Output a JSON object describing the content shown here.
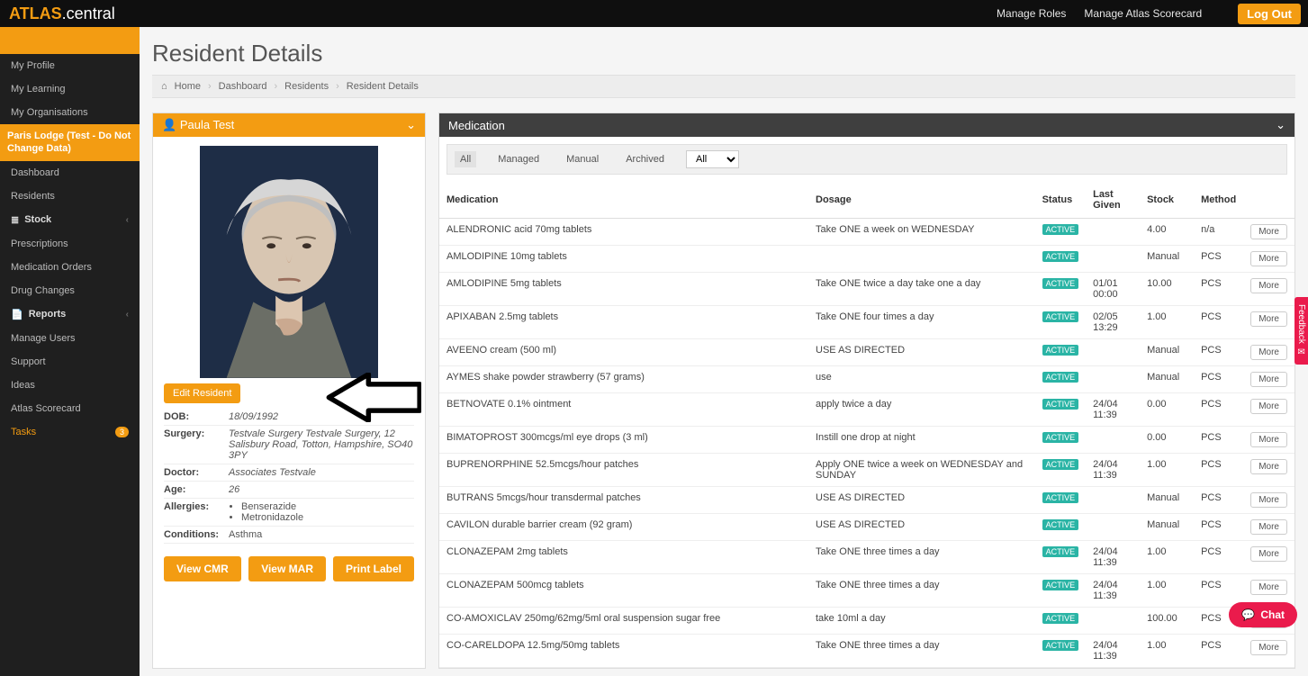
{
  "brand": {
    "part1": "ATLAS",
    "part2": ".central"
  },
  "top_nav": {
    "roles": "Manage Roles",
    "scorecard": "Manage Atlas Scorecard",
    "logout": "Log Out"
  },
  "sidebar": {
    "profile": "My Profile",
    "learning": "My Learning",
    "orgs": "My Organisations",
    "site": "Paris Lodge (Test - Do Not Change Data)",
    "dashboard": "Dashboard",
    "residents": "Residents",
    "stock": "Stock",
    "prescriptions": "Prescriptions",
    "med_orders": "Medication Orders",
    "drug_changes": "Drug Changes",
    "reports": "Reports",
    "manage_users": "Manage Users",
    "support": "Support",
    "ideas": "Ideas",
    "scorecard": "Atlas Scorecard",
    "tasks": "Tasks",
    "tasks_count": "3"
  },
  "page_title": "Resident Details",
  "breadcrumbs": [
    "Home",
    "Dashboard",
    "Residents",
    "Resident Details"
  ],
  "resident": {
    "name": "Paula Test",
    "edit_btn": "Edit Resident",
    "labels": {
      "dob": "DOB:",
      "surgery": "Surgery:",
      "doctor": "Doctor:",
      "age": "Age:",
      "allergies": "Allergies:",
      "conditions": "Conditions:"
    },
    "dob": "18/09/1992",
    "surgery": "Testvale Surgery Testvale Surgery, 12 Salisbury Road, Totton, Hampshire, SO40 3PY",
    "doctor": "Associates Testvale",
    "age": "26",
    "allergies": [
      "Benserazide",
      "Metronidazole"
    ],
    "conditions": "Asthma",
    "view_cmr": "View CMR",
    "view_mar": "View MAR",
    "print_label": "Print Label"
  },
  "med_panel": {
    "title": "Medication",
    "tabs": {
      "all": "All",
      "managed": "Managed",
      "manual": "Manual",
      "archived": "Archived"
    },
    "select": "All",
    "columns": {
      "medication": "Medication",
      "dosage": "Dosage",
      "status": "Status",
      "last_given": "Last Given",
      "stock": "Stock",
      "method": "Method"
    },
    "more": "More",
    "rows": [
      {
        "med": "ALENDRONIC acid 70mg tablets",
        "dosage": "Take ONE a week on WEDNESDAY",
        "status": "ACTIVE",
        "last_given": "",
        "stock": "4.00",
        "method": "n/a"
      },
      {
        "med": "AMLODIPINE 10mg tablets",
        "dosage": "",
        "status": "ACTIVE",
        "last_given": "",
        "stock": "Manual",
        "method": "PCS"
      },
      {
        "med": "AMLODIPINE 5mg tablets",
        "dosage": "Take ONE twice a day take one a day",
        "status": "ACTIVE",
        "last_given": "01/01\n00:00",
        "stock": "10.00",
        "method": "PCS"
      },
      {
        "med": "APIXABAN 2.5mg tablets",
        "dosage": "Take ONE four times a day",
        "status": "ACTIVE",
        "last_given": "02/05\n13:29",
        "stock": "1.00",
        "method": "PCS"
      },
      {
        "med": "AVEENO cream (500 ml)",
        "dosage": "USE AS DIRECTED",
        "status": "ACTIVE",
        "last_given": "",
        "stock": "Manual",
        "method": "PCS"
      },
      {
        "med": "AYMES shake powder strawberry (57 grams)",
        "dosage": "use",
        "status": "ACTIVE",
        "last_given": "",
        "stock": "Manual",
        "method": "PCS"
      },
      {
        "med": "BETNOVATE 0.1% ointment",
        "dosage": "apply twice a day",
        "status": "ACTIVE",
        "last_given": "24/04\n11:39",
        "stock": "0.00",
        "method": "PCS"
      },
      {
        "med": "BIMATOPROST 300mcgs/ml eye drops (3 ml)",
        "dosage": "Instill one drop at night",
        "status": "ACTIVE",
        "last_given": "",
        "stock": "0.00",
        "method": "PCS"
      },
      {
        "med": "BUPRENORPHINE 52.5mcgs/hour patches",
        "dosage": "Apply ONE twice a week on WEDNESDAY and SUNDAY",
        "status": "ACTIVE",
        "last_given": "24/04\n11:39",
        "stock": "1.00",
        "method": "PCS"
      },
      {
        "med": "BUTRANS 5mcgs/hour transdermal patches",
        "dosage": "USE AS DIRECTED",
        "status": "ACTIVE",
        "last_given": "",
        "stock": "Manual",
        "method": "PCS"
      },
      {
        "med": "CAVILON durable barrier cream (92 gram)",
        "dosage": "USE AS DIRECTED",
        "status": "ACTIVE",
        "last_given": "",
        "stock": "Manual",
        "method": "PCS"
      },
      {
        "med": "CLONAZEPAM 2mg tablets",
        "dosage": "Take ONE three times a day",
        "status": "ACTIVE",
        "last_given": "24/04\n11:39",
        "stock": "1.00",
        "method": "PCS"
      },
      {
        "med": "CLONAZEPAM 500mcg tablets",
        "dosage": "Take ONE three times a day",
        "status": "ACTIVE",
        "last_given": "24/04\n11:39",
        "stock": "1.00",
        "method": "PCS"
      },
      {
        "med": "CO-AMOXICLAV 250mg/62mg/5ml oral suspension sugar free",
        "dosage": "take 10ml a day",
        "status": "ACTIVE",
        "last_given": "",
        "stock": "100.00",
        "method": "PCS"
      },
      {
        "med": "CO-CARELDOPA 12.5mg/50mg tablets",
        "dosage": "Take ONE three times a day",
        "status": "ACTIVE",
        "last_given": "24/04\n11:39",
        "stock": "1.00",
        "method": "PCS"
      }
    ]
  },
  "feedback": "Feedback",
  "chat": "Chat"
}
